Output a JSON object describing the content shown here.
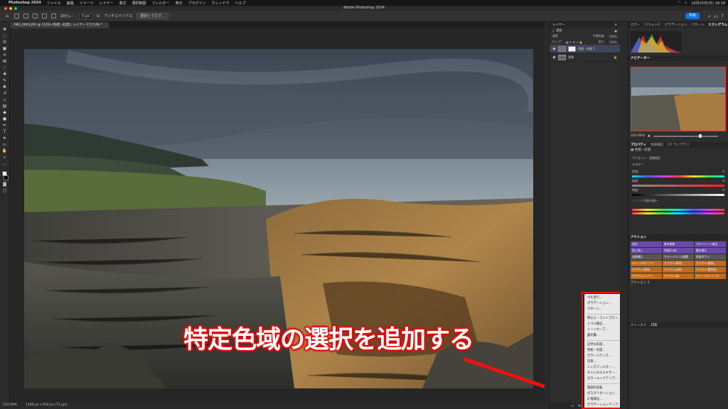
{
  "menubar": {
    "app_name": "Photoshop 2024",
    "items": [
      "ファイル",
      "編集",
      "イメージ",
      "レイヤー",
      "書式",
      "選択範囲",
      "フィルター",
      "表示",
      "プラグイン",
      "ウィンドウ",
      "ヘルプ"
    ],
    "clock": "10月20日(日) 18:18"
  },
  "window": {
    "title": "Adobe Photoshop 2024"
  },
  "options": {
    "feather_label": "ぼかし：",
    "feather_value": "0 px",
    "antialias_label": "アンチエイリアス",
    "select_mask_label": "選択とマスク...",
    "share_label": "共有"
  },
  "document": {
    "tab_title": "IMG_0063.JPG @ 315% (色相・彩度1, レイヤーマスク/8) *",
    "zoom": "314.69%",
    "dimensions": "1280 px x 854 px (72 ppi)"
  },
  "layers_panel": {
    "tab": "レイヤー",
    "kind_filter": "種類",
    "blend_mode": "通常",
    "opacity_label": "不透明度：",
    "opacity_value": "100%",
    "lock_label": "ロック：",
    "fill_label": "塗り：",
    "fill_value": "100%",
    "layers": [
      {
        "name": "色相・彩度 1",
        "type": "adjustment"
      },
      {
        "name": "背景",
        "type": "photo"
      }
    ]
  },
  "adjustment_menu": {
    "items": [
      "べた塗り...",
      "グラデーション...",
      "パターン...",
      "---",
      "明るさ・コントラスト...",
      "レベル補正...",
      "トーンカーブ...",
      "露光量...",
      "---",
      "自然な彩度...",
      "色相・彩度...",
      "カラーバランス...",
      "白黒...",
      "レンズフィルター...",
      "チャンネルミキサー...",
      "カラールックアップ...",
      "---",
      "階調の反転",
      "ポスタリゼーション...",
      "2 階調化...",
      "グラデーションマップ...",
      "特定色域の選択..."
    ],
    "selected": "特定色域の選択..."
  },
  "caption": {
    "text": "特定色域の選択を追加する",
    "color": "#ffffff",
    "outline_color": "#e01010"
  },
  "right_panel": {
    "top_tabs": [
      "カラー",
      "スウォッチ",
      "グラデーション",
      "パターン",
      "ヒストグラム"
    ],
    "active_top_tab": "ヒストグラム",
    "navigator_label": "ナビゲーター",
    "navigator_zoom": "314.69%",
    "props_tabs": [
      "プロパティ",
      "色調補正",
      "CC ライブラリ"
    ],
    "props_title": "色相・彩度",
    "preset_label": "プリセット：",
    "preset_value": "初期設定",
    "channel_value": "マスター",
    "hue_label": "色相：",
    "hue_value": "0",
    "sat_label": "彩度：",
    "sat_value": "0",
    "light_label": "明度：",
    "light_value": "0",
    "colorize_label": "色彩の統一",
    "actions_label": "アクション",
    "actions": [
      {
        "label": "保存",
        "color": "purple"
      },
      {
        "label": "基本現像",
        "color": "purple"
      },
      {
        "label": "スキントーン抽出",
        "color": "purple"
      },
      {
        "label": "洗い流し",
        "color": "purple"
      },
      {
        "label": "色補正(赤)",
        "color": "purple"
      },
      {
        "label": "露出補正",
        "color": "purple"
      },
      {
        "label": "自動補正",
        "color": "gray"
      },
      {
        "label": "カラーバランス調整",
        "color": "gray"
      },
      {
        "label": "彩度ダウン",
        "color": "gray"
      },
      {
        "label": "ティールオレンジ",
        "color": "orange"
      },
      {
        "label": "カラグレ(青系)",
        "color": "orange"
      },
      {
        "label": "カラグレ(黄系)",
        "color": "orange"
      },
      {
        "label": "カラグレ(緑系)",
        "color": "orange"
      },
      {
        "label": "カラグレ(赤系)",
        "color": "orange"
      },
      {
        "label": "カラグレ(暖色系)",
        "color": "orange"
      },
      {
        "label": "カラグレ(シアン)",
        "color": "orange"
      },
      {
        "label": "カラグレ(青)",
        "color": "orange"
      },
      {
        "label": "ティールオレンジ2",
        "color": "orange"
      }
    ],
    "action_set": "アクション 1",
    "bottom_tabs": [
      "チャンネル",
      "パス"
    ]
  },
  "colors": {
    "highlight_red": "#ee1111",
    "menu_select_blue": "#2f6fd6",
    "accent_blue": "#1473e6"
  }
}
